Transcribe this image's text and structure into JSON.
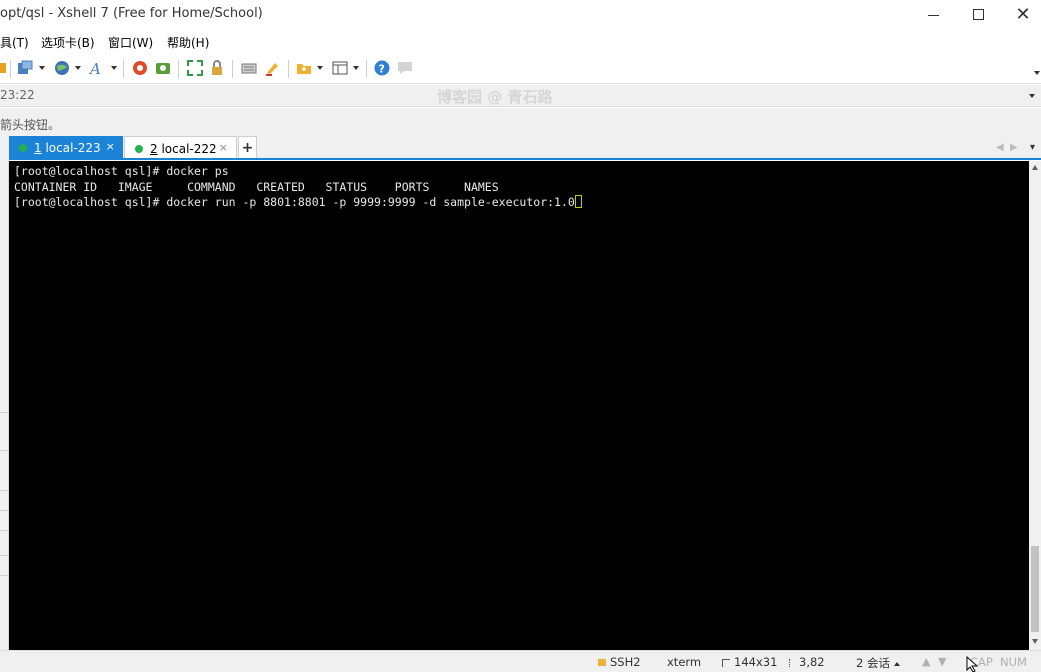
{
  "window": {
    "title": "opt/qsl - Xshell 7 (Free for Home/School)",
    "controls": {
      "minimize": "—",
      "close": "✕"
    }
  },
  "menu": [
    "具(T)",
    "选项卡(B)",
    "窗口(W)",
    "帮助(H)"
  ],
  "toolbar": {
    "icons": [
      "new-session-icon",
      "globe-icon",
      "font-icon",
      "xftp-icon",
      "xagent-icon",
      "fullscreen-icon",
      "lock-icon",
      "keyboard-icon",
      "highlight-icon",
      "folder-icon",
      "layout-icon",
      "help-icon",
      "chat-icon"
    ]
  },
  "address": {
    "text": "23:22",
    "watermark": "博客园 @ 青石路"
  },
  "hint": {
    "text": "箭头按钮。"
  },
  "tabs": [
    {
      "num": "1",
      "label": " local-223",
      "close": "×",
      "active": true
    },
    {
      "num": "2",
      "label": " local-222",
      "close": "×",
      "active": false
    }
  ],
  "tab_add": "+",
  "tab_nav": {
    "prev": "◀",
    "next": "▶",
    "menu": "▾"
  },
  "terminal": {
    "lines": [
      "[root@localhost qsl]# docker ps",
      "CONTAINER ID   IMAGE     COMMAND   CREATED   STATUS    PORTS     NAMES",
      "[root@localhost qsl]# docker run -p 8801:8801 -p 9999:9999 -d sample-executor:1.0"
    ]
  },
  "status": {
    "protocol": "SSH2",
    "term": "xterm",
    "size": "144x31",
    "cursor": "3,82",
    "sessions": "2 会话",
    "cap": "CAP",
    "num": "NUM"
  },
  "colors": {
    "tab_active": "#1b84d6",
    "terminal_bg": "#000000",
    "terminal_fg": "#e8e8e8",
    "status_dot": "#22b14c"
  }
}
